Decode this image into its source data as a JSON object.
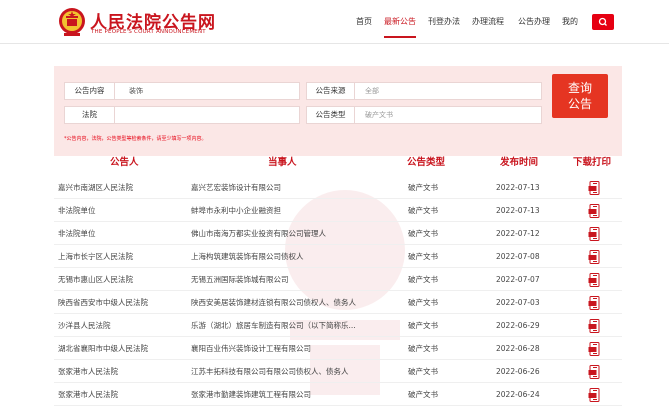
{
  "header": {
    "logo_title": "人民法院公告网",
    "logo_subtitle": "THE PEOPLE'S COURT ANNOUNCEMENT",
    "nav": [
      "首页",
      "最新公告",
      "刊登办法",
      "办理流程",
      "公告办理",
      "我的"
    ],
    "active_nav": "最新公告",
    "brand_color": "#c9151e"
  },
  "search": {
    "content_label": "公告内容",
    "content_value": "装饰",
    "court_label": "法院",
    "court_value": "",
    "source_label": "公告来源",
    "source_value": "全部",
    "type_label": "公告类型",
    "type_value": "破产文书",
    "query_line1": "查询",
    "query_line2": "公告",
    "hint": "*公告内容，法院，公告类型等检索条件，请至少填写一项内容。"
  },
  "table": {
    "headers": [
      "公告人",
      "当事人",
      "公告类型",
      "发布时间",
      "下载打印"
    ],
    "rows": [
      {
        "announcer": "嘉兴市南湖区人民法院",
        "party": "嘉兴艺宏装饰设计有限公司",
        "type": "破产文书",
        "date": "2022-07-13"
      },
      {
        "announcer": "非法院单位",
        "party": "蚌埠市永利中小企业融资担",
        "type": "破产文书",
        "date": "2022-07-13"
      },
      {
        "announcer": "非法院单位",
        "party": "佛山市南海万都实业投资有限公司管理人",
        "type": "破产文书",
        "date": "2022-07-12"
      },
      {
        "announcer": "上海市长宁区人民法院",
        "party": "上海构筑建筑装饰有限公司债权人",
        "type": "破产文书",
        "date": "2022-07-08"
      },
      {
        "announcer": "无锡市惠山区人民法院",
        "party": "无锡五洲国际装饰城有限公司",
        "type": "破产文书",
        "date": "2022-07-07"
      },
      {
        "announcer": "陕西省西安市中级人民法院",
        "party": "陕西安美居装饰建材连锁有限公司债权人、债务人",
        "type": "破产文书",
        "date": "2022-07-03"
      },
      {
        "announcer": "沙洋县人民法院",
        "party": "乐游（湖北）旅居车制造有限公司（以下简称乐...",
        "type": "破产文书",
        "date": "2022-06-29"
      },
      {
        "announcer": "湖北省襄阳市中级人民法院",
        "party": "襄阳百业伟兴装饰设计工程有限公司",
        "type": "破产文书",
        "date": "2022-06-28"
      },
      {
        "announcer": "张家港市人民法院",
        "party": "江苏丰拓科技有限公司有限公司债权人、债务人",
        "type": "破产文书",
        "date": "2022-06-26"
      },
      {
        "announcer": "张家港市人民法院",
        "party": "张家港市勤建装饰建筑工程有限公司",
        "type": "破产文书",
        "date": "2022-06-24"
      }
    ]
  }
}
